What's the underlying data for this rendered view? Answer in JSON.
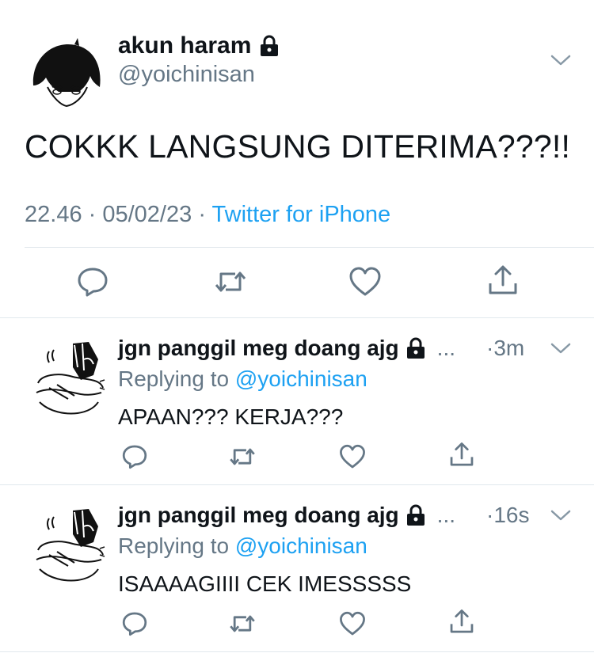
{
  "main_tweet": {
    "author_name": "akun haram",
    "handle": "@yoichinisan",
    "text": "COKKK LANGSUNG DITERIMA???!!",
    "time": "22.46",
    "date": "05/02/23",
    "source": "Twitter for iPhone",
    "icons": [
      "lock-icon",
      "chevron-down-icon",
      "reply-icon",
      "retweet-icon",
      "like-icon",
      "share-icon"
    ]
  },
  "replies": [
    {
      "author_name": "jgn panggil meg doang ajg",
      "ellipsis": "...",
      "time": "3m",
      "replying_prefix": "Replying to",
      "replying_to": "@yoichinisan",
      "text": "APAAN??? KERJA???"
    },
    {
      "author_name": "jgn panggil meg doang ajg",
      "ellipsis": "...",
      "time": "16s",
      "replying_prefix": "Replying to",
      "replying_to": "@yoichinisan",
      "text": "ISAAAAGIIII CEK IMESSSSS"
    }
  ],
  "colors": {
    "text": "#0f1419",
    "secondary": "#657786",
    "link": "#1da1f2",
    "divider": "#e1e8ed"
  }
}
